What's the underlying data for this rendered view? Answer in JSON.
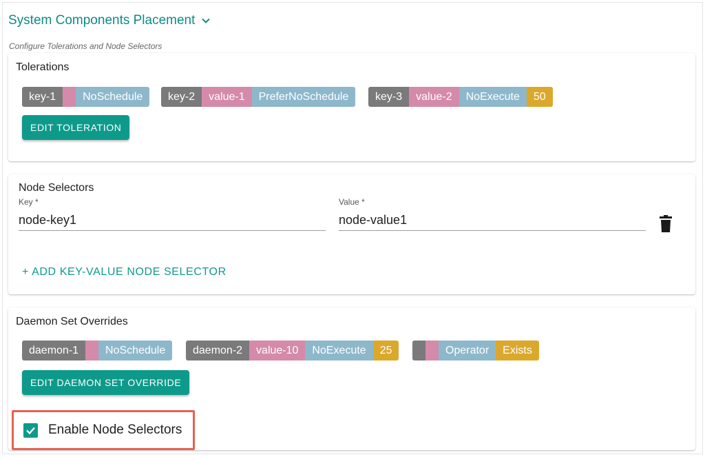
{
  "header": {
    "title": "System Components Placement",
    "subtitle": "Configure Tolerations and Node Selectors"
  },
  "tolerations": {
    "title": "Tolerations",
    "chips": [
      [
        "key-1",
        "",
        "NoSchedule"
      ],
      [
        "key-2",
        "value-1",
        "PreferNoSchedule"
      ],
      [
        "key-3",
        "value-2",
        "NoExecute",
        "50"
      ]
    ],
    "edit_button": "EDIT TOLERATION"
  },
  "node_selectors": {
    "title": "Node Selectors",
    "key_label": "Key *",
    "key_value": "node-key1",
    "value_label": "Value *",
    "value_value": "node-value1",
    "add_label": "+ ADD KEY-VALUE NODE SELECTOR"
  },
  "daemon": {
    "title": "Daemon Set Overrides",
    "chips": [
      [
        "daemon-1",
        "",
        "NoSchedule"
      ],
      [
        "daemon-2",
        "value-10",
        "NoExecute",
        "25"
      ],
      [
        "",
        "",
        "Operator",
        "Exists"
      ]
    ],
    "edit_button": "EDIT DAEMON SET OVERRIDE"
  },
  "enable_node_selectors": {
    "label": "Enable Node Selectors",
    "checked": true
  },
  "colors": {
    "accent": "#0e9a8b",
    "chip_key": "#7a7a7a",
    "chip_value": "#d48aa8",
    "chip_effect": "#8db8cb",
    "chip_number": "#dba82c",
    "highlight": "#e8604f"
  },
  "icons": {
    "collapse": "chevron-down-icon",
    "delete": "trash-icon",
    "check": "check-icon"
  }
}
